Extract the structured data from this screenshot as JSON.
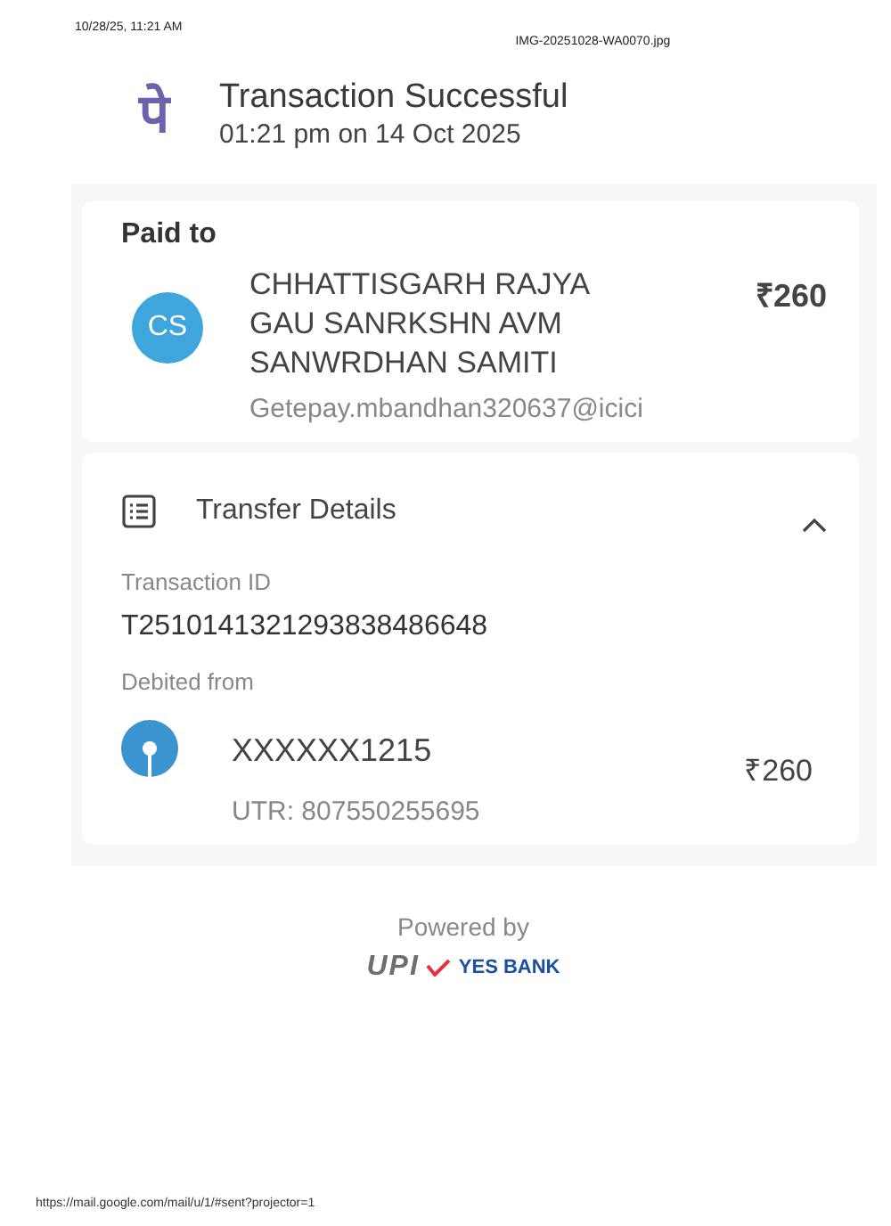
{
  "print_header": {
    "date": "10/28/25, 11:21 AM",
    "file_name": "IMG-20251028-WA0070.jpg"
  },
  "header": {
    "logo": "पे",
    "title": "Transaction Successful",
    "time": "01:21 pm on 14 Oct 2025"
  },
  "paid_to": {
    "heading": "Paid to",
    "avatar": "CS",
    "name_lines": [
      "CHHATTISGARH RAJYA",
      "GAU SANRKSHN AVM",
      "SANWRDHAN SAMITI"
    ],
    "upi_id": "Getepay.mbandhan320637@icici",
    "amount": "₹260"
  },
  "transfer_details": {
    "title": "Transfer Details",
    "expanded": true,
    "transaction_id_label": "Transaction ID",
    "transaction_id": "T2510141321293838486648",
    "debited_label": "Debited from",
    "account": "XXXXXX1215",
    "amount": "₹260",
    "utr": "UTR: 807550255695"
  },
  "footer": {
    "powered_by": "Powered by",
    "upi": "UPI",
    "bank": "YES BANK"
  },
  "print_footer": {
    "url": "https://mail.google.com/mail/u/1/#sent?projector=1"
  }
}
